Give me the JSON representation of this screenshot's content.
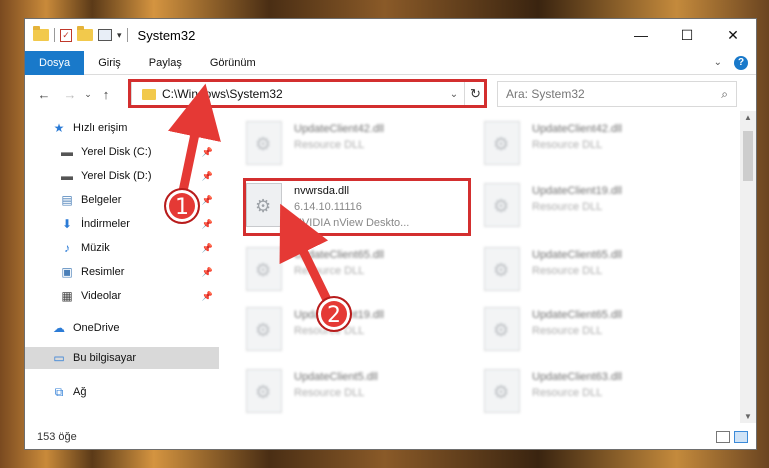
{
  "window": {
    "title": "System32",
    "controls": {
      "minimize": "—",
      "maximize": "☐",
      "close": "✕"
    }
  },
  "ribbon": {
    "tabs": [
      "Dosya",
      "Giriş",
      "Paylaş",
      "Görünüm"
    ],
    "active_tab": "Dosya"
  },
  "nav": {
    "address": "C:\\Windows\\System32",
    "search_placeholder": "Ara: System32"
  },
  "sidebar": {
    "items": [
      {
        "label": "Hızlı erişim",
        "icon": "star-icon"
      },
      {
        "label": "Yerel Disk (C:)",
        "icon": "drive-icon"
      },
      {
        "label": "Yerel Disk (D:)",
        "icon": "drive-icon"
      },
      {
        "label": "Belgeler",
        "icon": "document-icon"
      },
      {
        "label": "İndirmeler",
        "icon": "download-icon"
      },
      {
        "label": "Müzik",
        "icon": "music-icon"
      },
      {
        "label": "Resimler",
        "icon": "pictures-icon"
      },
      {
        "label": "Videolar",
        "icon": "video-icon"
      },
      {
        "label": "OneDrive",
        "icon": "cloud-icon"
      },
      {
        "label": "Bu bilgisayar",
        "icon": "computer-icon"
      },
      {
        "label": "Ağ",
        "icon": "network-icon"
      }
    ],
    "selected": "Bu bilgisayar"
  },
  "files": {
    "focused": {
      "name": "nvwrsda.dll",
      "version": "6.14.10.11116",
      "description": "NVIDIA nView Deskto..."
    },
    "tiles": [
      {
        "name": "UpdateClient42.dll",
        "type": "Resource DLL"
      },
      {
        "name": "UpdateClient42.dll",
        "type": "Resource DLL"
      },
      {
        "name": "UpdateClient19.dll",
        "type": "Resource DLL"
      },
      {
        "name": "UpdateClient65.dll",
        "type": "Resource DLL"
      },
      {
        "name": "UpdateClient65.dll",
        "type": "Resource DLL"
      },
      {
        "name": "UpdateClient19.dll",
        "type": "Resource DLL"
      },
      {
        "name": "UpdateClient65.dll",
        "type": "Resource DLL"
      },
      {
        "name": "UpdateClient5.dll",
        "type": "Resource DLL"
      },
      {
        "name": "UpdateClient63.dll",
        "type": "Resource DLL"
      }
    ]
  },
  "status": {
    "count": "153 öğe"
  },
  "annotations": {
    "step1": "1",
    "step2": "2",
    "highlight_color": "#d32f2f"
  }
}
